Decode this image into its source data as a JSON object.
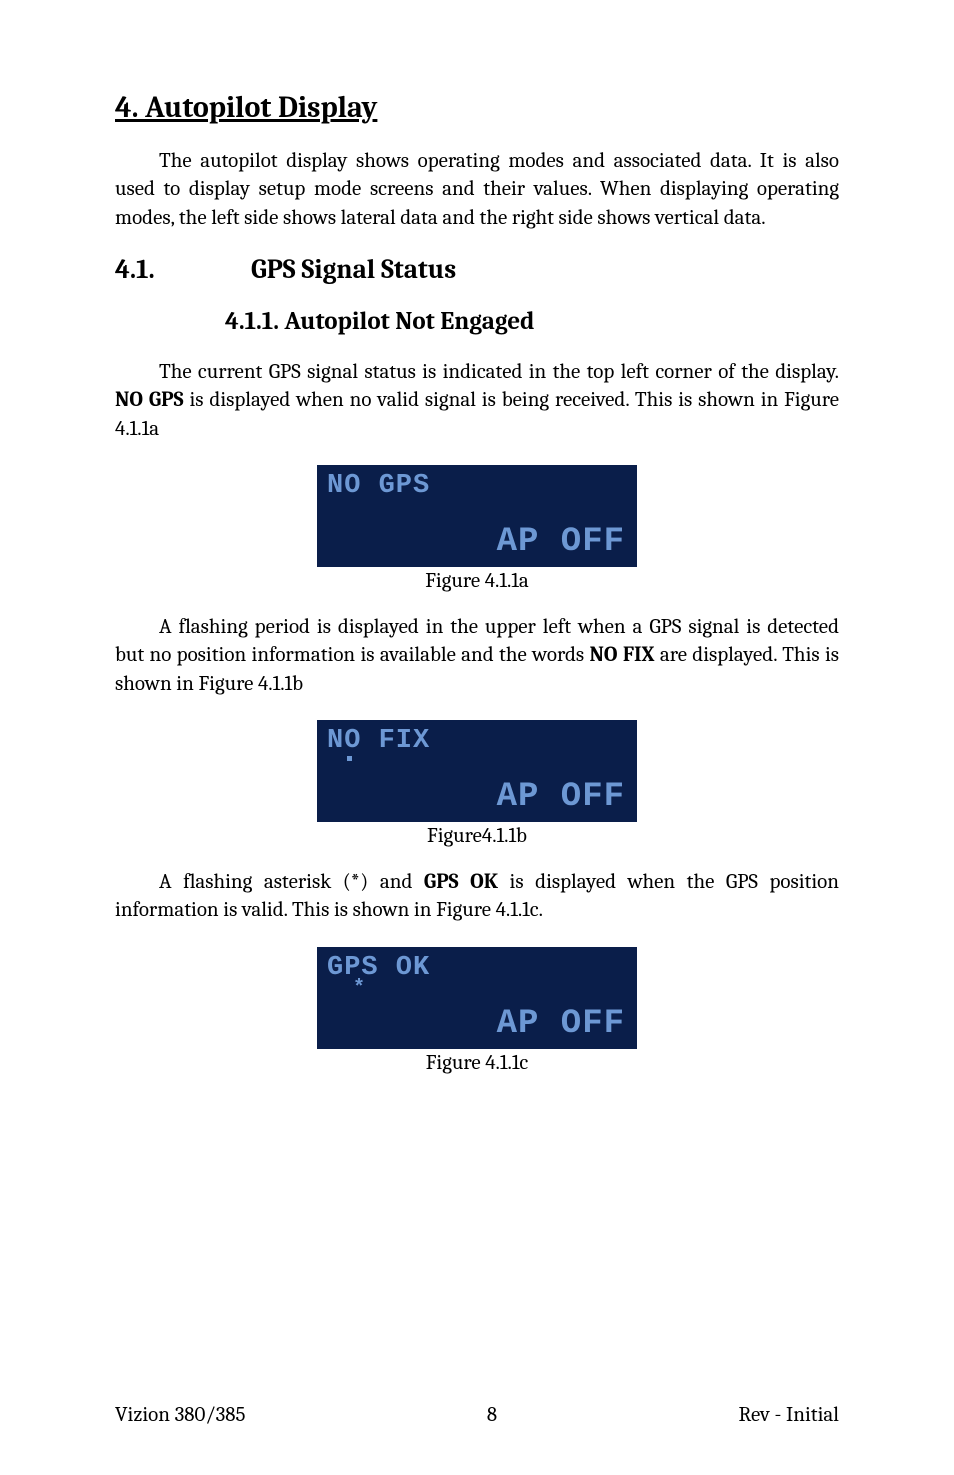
{
  "h1": "4.  Autopilot Display",
  "para1": "The autopilot display shows operating modes and associated data.  It is also used to display setup mode screens and their values.  When displaying operating modes, the left side shows lateral data and the right side shows vertical data.",
  "h2_num": "4.1.",
  "h2_title": "GPS Signal Status",
  "h3": "4.1.1.  Autopilot Not Engaged",
  "para2_a": "The current GPS signal status is indicated in the top left corner of the display.   ",
  "para2_b": "NO GPS",
  "para2_c": " is displayed when no valid signal is being received.  This is shown in Figure 4.1.1a",
  "fig1_top": "NO GPS",
  "fig1_bottom": "AP OFF",
  "fig1_caption": "Figure 4.1.1a",
  "para3_a": "A flashing period is displayed in the upper left when a GPS signal is detected but no position information is available and the words ",
  "para3_b": "NO FIX",
  "para3_c": " are displayed.  This is shown in Figure 4.1.1b",
  "fig2_top": "NO FIX",
  "fig2_bottom": "AP OFF",
  "fig2_caption": "Figure4.1.1b",
  "para4_a": "A flashing asterisk (",
  "para4_b": "*",
  "para4_c": ") and ",
  "para4_d": "GPS OK",
  "para4_e": " is displayed when the GPS position information is valid.  This is shown in Figure 4.1.1c.",
  "fig3_top": "GPS OK",
  "fig3_star": "*",
  "fig3_bottom": "AP OFF",
  "fig3_caption": "Figure 4.1.1c",
  "footer_left": "Vizion 380/385",
  "footer_center": "8",
  "footer_right": "Rev - Initial"
}
